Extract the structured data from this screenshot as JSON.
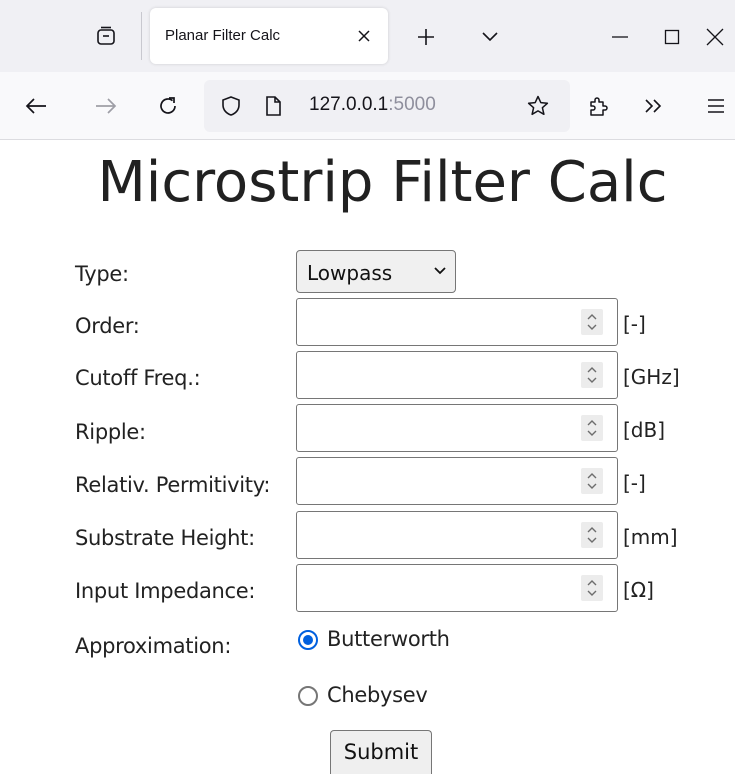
{
  "browser": {
    "tab_title": "Planar Filter Calc",
    "url_host": "127.0.0.1",
    "url_port": ":5000"
  },
  "page": {
    "title": "Microstrip Filter Calc"
  },
  "form": {
    "type_label": "Type:",
    "type_value": "Lowpass",
    "fields": [
      {
        "label": "Order:",
        "value": "",
        "unit": "[-]"
      },
      {
        "label": "Cutoff Freq.:",
        "value": "",
        "unit": "[GHz]"
      },
      {
        "label": "Ripple:",
        "value": "",
        "unit": "[dB]"
      },
      {
        "label": "Relativ. Permitivity:",
        "value": "",
        "unit": "[-]"
      },
      {
        "label": "Substrate Height:",
        "value": "",
        "unit": "[mm]"
      },
      {
        "label": "Input Impedance:",
        "value": "",
        "unit": "[Ω]"
      }
    ],
    "approximation_label": "Approximation:",
    "approximation_options": [
      {
        "label": "Butterworth",
        "checked": true
      },
      {
        "label": "Chebysev",
        "checked": false
      }
    ],
    "submit_label": "Submit"
  },
  "colors": {
    "accent": "#0060df",
    "tabbar_bg": "#f0f0f4",
    "navbar_bg": "#f9f9fb"
  }
}
